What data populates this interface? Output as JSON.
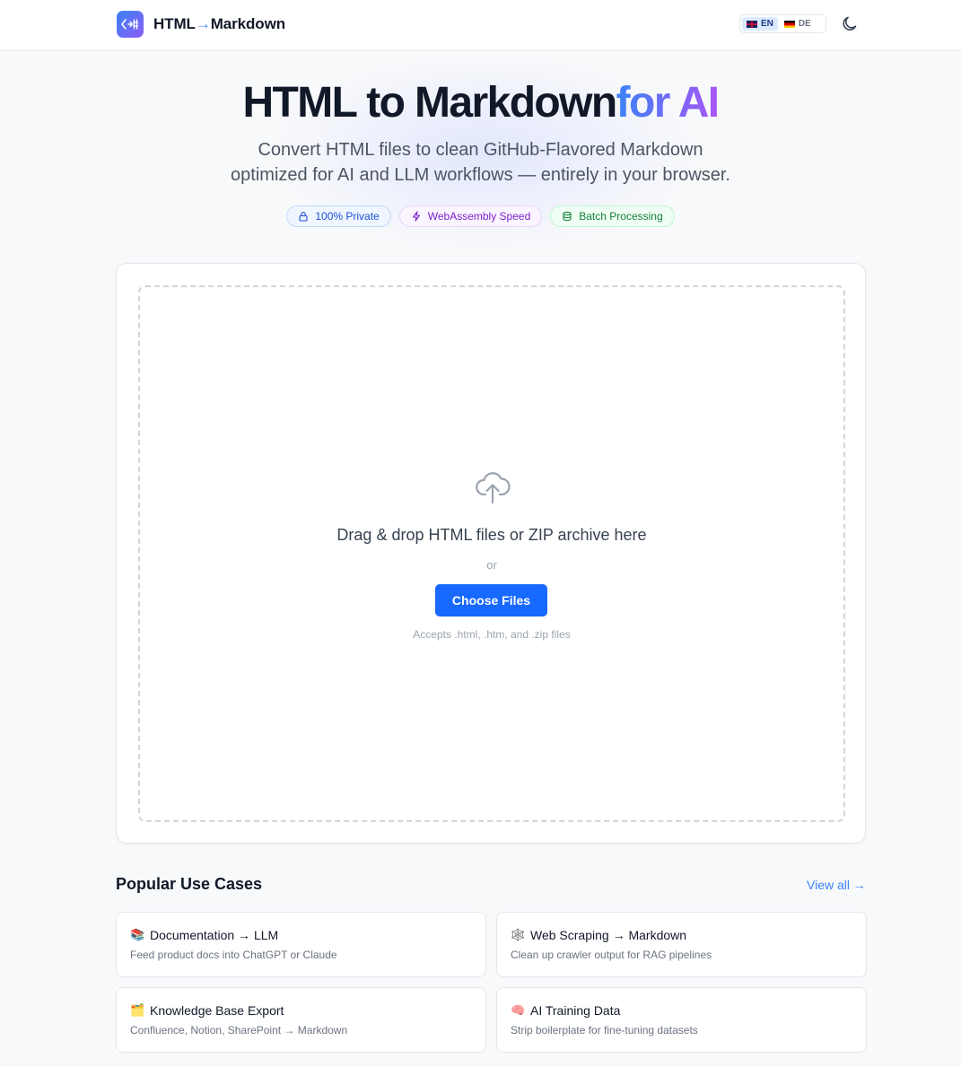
{
  "header": {
    "brand_left": "HTML",
    "brand_arrow": "→",
    "brand_right": "Markdown",
    "languages": [
      {
        "code": "EN",
        "flag": "uk-flag",
        "active": true
      },
      {
        "code": "DE",
        "flag": "de-flag",
        "active": false
      }
    ],
    "theme_icon": "moon-icon"
  },
  "hero": {
    "title_main": "HTML to Markdown",
    "title_accent": "for AI",
    "subtitle_line1": "Convert HTML files to clean GitHub-Flavored Markdown",
    "subtitle_line2": "optimized for AI and LLM workflows — entirely in your browser.",
    "badges": [
      {
        "label": "100% Private",
        "icon": "lock-icon"
      },
      {
        "label": "WebAssembly Speed",
        "icon": "lightning-icon"
      },
      {
        "label": "Batch Processing",
        "icon": "database-icon"
      }
    ]
  },
  "upload": {
    "icon": "cloud-upload-icon",
    "drop_text": "Drag & drop HTML files or ZIP archive here",
    "or_text": "or",
    "button_label": "Choose Files",
    "accepts_text": "Accepts .html, .htm, and .zip files"
  },
  "use_cases": {
    "heading": "Popular Use Cases",
    "view_all": "View all →",
    "items": [
      {
        "emoji": "📚",
        "title": "Documentation → LLM",
        "desc": "Feed product docs into ChatGPT or Claude"
      },
      {
        "emoji": "🕸️",
        "title": "Web Scraping → Markdown",
        "desc": "Clean up crawler output for RAG pipelines"
      },
      {
        "emoji": "🗂️",
        "title": "Knowledge Base Export",
        "desc": "Confluence, Notion, SharePoint → Markdown"
      },
      {
        "emoji": "🧠",
        "title": "AI Training Data",
        "desc": "Strip boilerplate for fine-tuning datasets"
      }
    ]
  },
  "colors": {
    "primary": "#1769ff",
    "accent_gradient_start": "#3b82f6",
    "accent_gradient_end": "#a855f7"
  }
}
